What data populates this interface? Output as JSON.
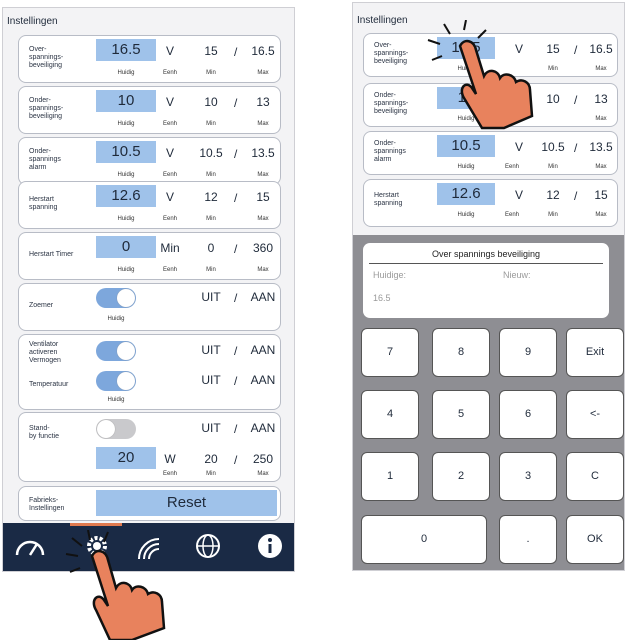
{
  "left": {
    "title": "Instellingen",
    "rows": [
      {
        "label": "Over-\nspannings-\nbeveiliging",
        "value": "16.5",
        "unit": "V",
        "min": "15",
        "max": "16.5"
      },
      {
        "label": "Onder-\nspannings-\nbeveiliging",
        "value": "10",
        "unit": "V",
        "min": "10",
        "max": "13"
      },
      {
        "label": "Onder-\nspannings\nalarm",
        "value": "10.5",
        "unit": "V",
        "min": "10.5",
        "max": "13.5"
      },
      {
        "label": "Herstart\nspanning",
        "value": "12.6",
        "unit": "V",
        "min": "12",
        "max": "15"
      },
      {
        "label": "Herstart Timer",
        "value": "0",
        "unit": "Min",
        "min": "0",
        "max": "360"
      }
    ],
    "sub": {
      "huidig": "Huidig",
      "eenh": "Eenh",
      "min": "Min",
      "max": "Max"
    },
    "slash": "/",
    "zoemer": {
      "label": "Zoemer",
      "off": "UIT",
      "on": "AAN",
      "state": "on"
    },
    "ventilator": {
      "label1": "Ventilator\nactiveren\nVermogen",
      "label2": "Temperatuur",
      "off": "UIT",
      "on": "AAN"
    },
    "standby": {
      "label": "Stand-\nby functie",
      "off": "UIT",
      "on": "AAN",
      "value": "20",
      "unit": "W",
      "min": "20",
      "max": "250"
    },
    "fabrieks": {
      "label": "Fabrieks-\nInstellingen",
      "button": "Reset"
    },
    "tabs": [
      "gauge-icon",
      "gear-icon",
      "signal-icon",
      "globe-icon",
      "info-icon"
    ],
    "colors": {
      "value_box": "#9fc2ea",
      "tabbar": "#1a2a45",
      "toggle_on": "#7da7dc"
    }
  },
  "right": {
    "title": "Instellingen",
    "rows": [
      {
        "label": "Over-\nspannings-\nbeveiliging",
        "value": "16.5",
        "unit": "V",
        "min": "15",
        "max": "16.5"
      },
      {
        "label": "Onder-\nspannings-\nbeveiliging",
        "value": "10",
        "unit": "V",
        "min": "10",
        "max": "13"
      },
      {
        "label": "Onder-\nspannings\nalarm",
        "value": "10.5",
        "unit": "V",
        "min": "10.5",
        "max": "13.5"
      },
      {
        "label": "Herstart\nspanning",
        "value": "12.6",
        "unit": "V",
        "min": "12",
        "max": "15"
      }
    ],
    "dialog": {
      "title": "Over spannings beveiliging",
      "current_label": "Huidige:",
      "new_label": "Nieuw:",
      "current_value": "16.5"
    },
    "keys": [
      "7",
      "8",
      "9",
      "Exit",
      "4",
      "5",
      "6",
      "<-",
      "1",
      "2",
      "3",
      "C",
      "0",
      ".",
      "OK"
    ]
  }
}
